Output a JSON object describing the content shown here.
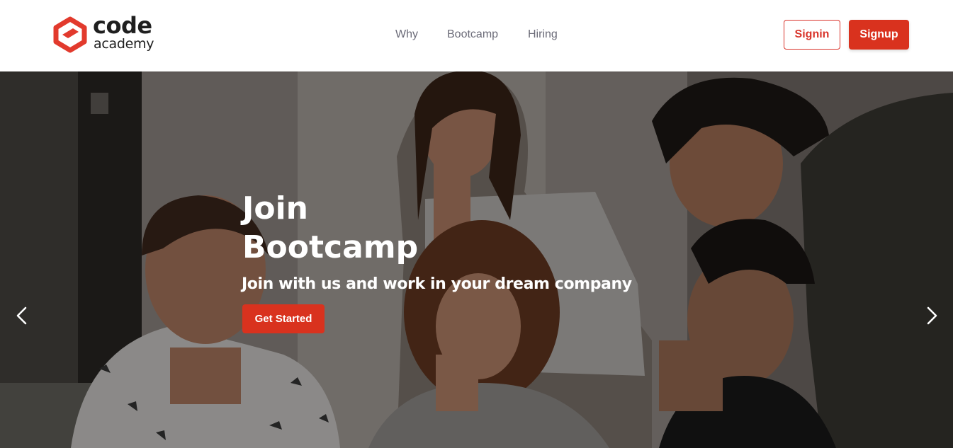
{
  "brand": {
    "name_line1": "code",
    "name_line2": "academy",
    "accent_color": "#d9321e"
  },
  "nav": {
    "items": [
      {
        "label": "Why"
      },
      {
        "label": "Bootcamp"
      },
      {
        "label": "Hiring"
      }
    ]
  },
  "auth": {
    "signin_label": "Signin",
    "signup_label": "Signup"
  },
  "hero": {
    "title": "Join Bootcamp",
    "subtitle": "Join with us and work in your dream company",
    "cta_label": "Get Started",
    "prev_icon": "chevron-left-icon",
    "next_icon": "chevron-right-icon"
  }
}
